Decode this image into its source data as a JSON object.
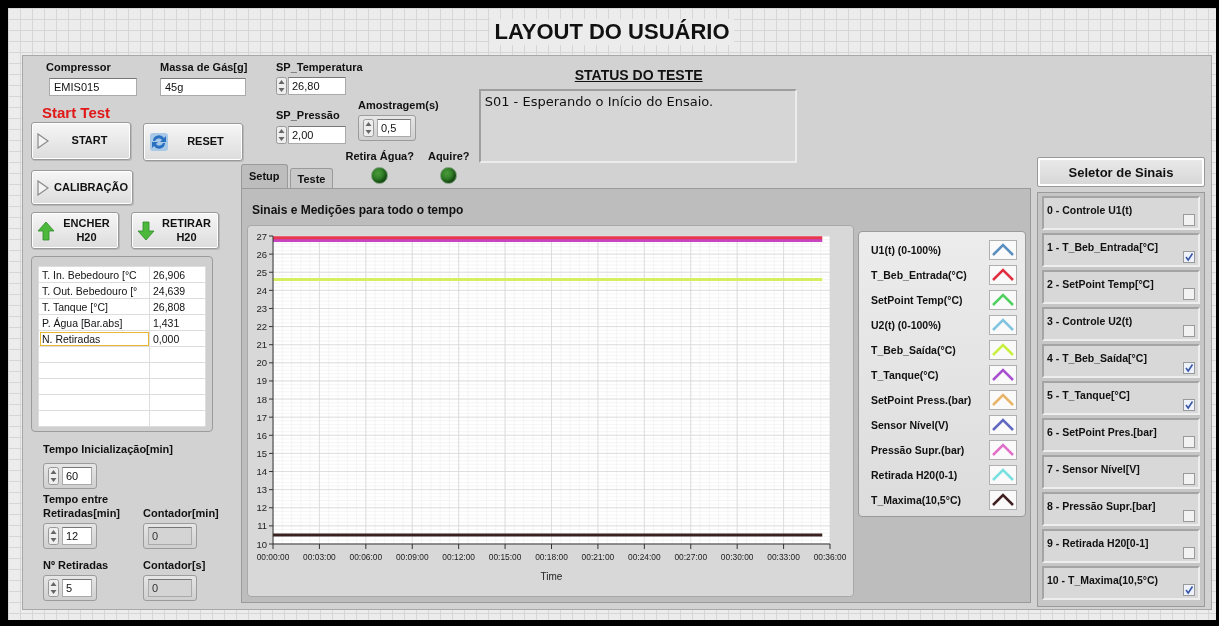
{
  "title": "LAYOUT DO USUÁRIO",
  "fields": [
    {
      "label": "Compressor",
      "value": "EMIS015"
    },
    {
      "label": "Massa de Gás[g]",
      "value": "45g"
    }
  ],
  "start_test_label": "Start Test",
  "buttons": [
    {
      "label": "START",
      "kind": "play"
    },
    {
      "label": "RESET",
      "kind": "refresh"
    },
    {
      "label": "CALIBRAÇÃO",
      "kind": "play"
    },
    {
      "label": "ENCHER\nH20",
      "kind": "up"
    },
    {
      "label": "RETIRAR\nH20",
      "kind": "down"
    }
  ],
  "setpoints": [
    {
      "label": "SP_Temperatura",
      "value": "26,80"
    },
    {
      "label": "SP_Pressão",
      "value": "2,00"
    }
  ],
  "sampling": {
    "label": "Amostragem(s)",
    "value": "0,5"
  },
  "status": {
    "title": "STATUS DO TESTE",
    "text": "S01 - Esperando o Início do Ensaio."
  },
  "leds": [
    {
      "label": "Retira Água?",
      "on": false
    },
    {
      "label": "Aquire?",
      "on": false
    }
  ],
  "tabs": [
    {
      "label": "Setup",
      "selected": true
    },
    {
      "label": "Teste",
      "selected": false
    }
  ],
  "measurements": {
    "rows": [
      {
        "name": "T. In. Bebedouro [°C",
        "value": "26,906",
        "selected": false
      },
      {
        "name": "T. Out. Bebedouro [°",
        "value": "24,639",
        "selected": false
      },
      {
        "name": "T. Tanque [°C]",
        "value": "26,808",
        "selected": false
      },
      {
        "name": "P. Água [Bar.abs]",
        "value": "1,431",
        "selected": false
      },
      {
        "name": "N. Retiradas",
        "value": "0,000",
        "selected": true
      }
    ]
  },
  "timers": [
    {
      "label": "Tempo Inicialização[min]",
      "value": "60",
      "kind": "control"
    },
    {
      "label": "Tempo entre Retiradas[min]",
      "value": "12",
      "kind": "control"
    },
    {
      "label": "Contador[min]",
      "value": "0",
      "kind": "indicator"
    },
    {
      "label": "Nº Retiradas",
      "value": "5",
      "kind": "control"
    },
    {
      "label": "Contador[s]",
      "value": "0",
      "kind": "indicator"
    }
  ],
  "chart_data": {
    "type": "line",
    "title": "Sinais e Medições para todo o tempo",
    "xlabel": "Time",
    "x": [
      0,
      35.5
    ],
    "xlim": [
      0,
      36
    ],
    "ylim": [
      10,
      27
    ],
    "xticks": [
      {
        "value": 0,
        "label": "00:00:00"
      },
      {
        "value": 3,
        "label": "00:03:00"
      },
      {
        "value": 6,
        "label": "00:06:00"
      },
      {
        "value": 9,
        "label": "00:09:00"
      },
      {
        "value": 12,
        "label": "00:12:00"
      },
      {
        "value": 15,
        "label": "00:15:00"
      },
      {
        "value": 18,
        "label": "00:18:00"
      },
      {
        "value": 21,
        "label": "00:21:00"
      },
      {
        "value": 24,
        "label": "00:24:00"
      },
      {
        "value": 27,
        "label": "00:27:00"
      },
      {
        "value": 30,
        "label": "00:30:00"
      },
      {
        "value": 33,
        "label": "00:33:00"
      },
      {
        "value": 36,
        "label": "00:36:00"
      }
    ],
    "yticks": [
      10,
      11,
      12,
      13,
      14,
      15,
      16,
      17,
      18,
      19,
      20,
      21,
      22,
      23,
      24,
      25,
      26,
      27
    ],
    "grid": true,
    "series": [
      {
        "color": "#c845c0",
        "values": [
          26.75,
          26.75
        ]
      },
      {
        "color": "#e8384e",
        "values": [
          26.9,
          26.9
        ]
      },
      {
        "color": "#d4f060",
        "values": [
          24.6,
          24.6
        ]
      },
      {
        "color": "#3a2020",
        "values": [
          10.5,
          10.5
        ]
      }
    ]
  },
  "legend": [
    {
      "label": "U1(t) (0-100%)",
      "color": "#5b8fc0"
    },
    {
      "label": "T_Beb_Entrada(°C)",
      "color": "#e03040"
    },
    {
      "label": "SetPoint Temp(°C)",
      "color": "#50d060"
    },
    {
      "label": "U2(t) (0-100%)",
      "color": "#80c4e0"
    },
    {
      "label": "T_Beb_Saída(°C)",
      "color": "#c8f040"
    },
    {
      "label": "T_Tanque(°C)",
      "color": "#a850d0"
    },
    {
      "label": "SetPoint Press.(bar)",
      "color": "#e8b468"
    },
    {
      "label": "Sensor Nível(V)",
      "color": "#6068c0"
    },
    {
      "label": "Pressão Supr.(bar)",
      "color": "#e070c8"
    },
    {
      "label": "Retirada H20(0-1)",
      "color": "#78e0e0"
    },
    {
      "label": "T_Maxima(10,5°C)",
      "color": "#402020"
    }
  ],
  "selector": {
    "title": "Seletor de Sinais",
    "items": [
      {
        "label": "0 - Controle U1(t)",
        "checked": false
      },
      {
        "label": "1 - T_Beb_Entrada[°C]",
        "checked": true
      },
      {
        "label": "2 - SetPoint Temp[°C]",
        "checked": false
      },
      {
        "label": "3 - Controle U2(t)",
        "checked": false
      },
      {
        "label": "4 - T_Beb_Saída[°C]",
        "checked": true
      },
      {
        "label": "5 - T_Tanque[°C]",
        "checked": true
      },
      {
        "label": "6 - SetPoint Pres.[bar]",
        "checked": false
      },
      {
        "label": "7 - Sensor Nível[V]",
        "checked": false
      },
      {
        "label": "8 - Pressão Supr.[bar]",
        "checked": false
      },
      {
        "label": "9 - Retirada H20[0-1]",
        "checked": false
      },
      {
        "label": "10 - T_Maxima(10,5°C)",
        "checked": true
      }
    ]
  }
}
